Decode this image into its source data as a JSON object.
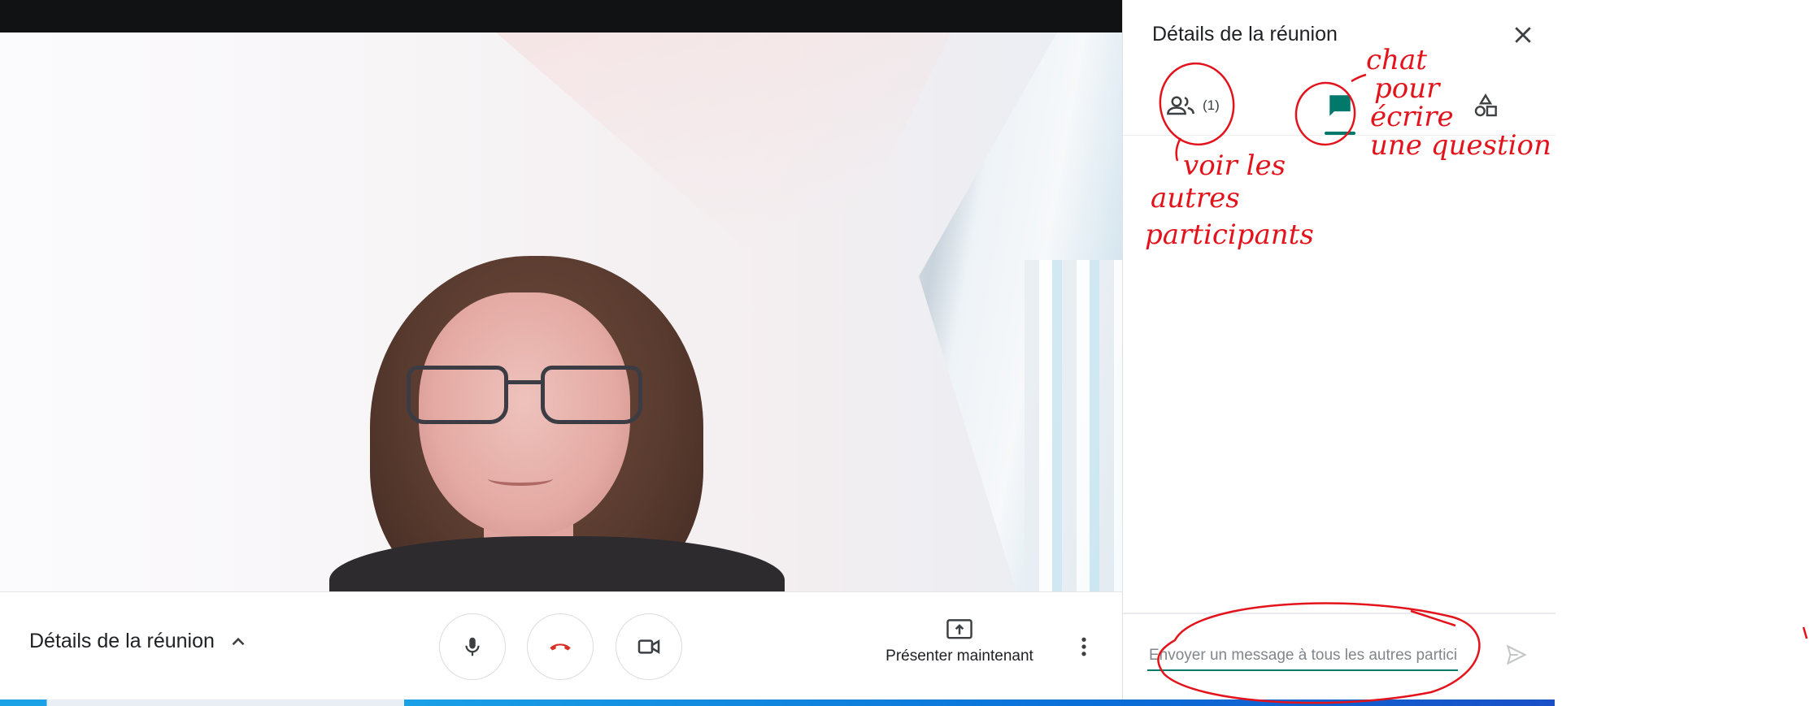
{
  "panel": {
    "title": "Détails de la réunion",
    "close_icon": "close-icon",
    "tabs": [
      {
        "name": "people",
        "icon": "people-icon",
        "count": "(1)"
      },
      {
        "name": "chat",
        "icon": "chat-icon",
        "active": true
      },
      {
        "name": "activities",
        "icon": "shapes-icon"
      }
    ],
    "message_input": {
      "placeholder": "Envoyer un message à tous les autres partici...",
      "value": ""
    },
    "send_icon": "send-icon"
  },
  "controls": {
    "meeting_details_label": "Détails de la réunion",
    "mic_icon": "mic-icon",
    "hangup_icon": "hangup-icon",
    "camera_icon": "camera-icon",
    "present_label": "Présenter maintenant",
    "present_icon": "present-screen-icon",
    "more_icon": "more-vert-icon"
  },
  "annotations": {
    "chat_note": [
      "chat",
      "pour",
      "écrire",
      "une question"
    ],
    "people_note": [
      "voir les",
      "autres",
      "participants"
    ]
  },
  "colors": {
    "accent": "#00796b",
    "hangup": "#d93025",
    "annotation_ink": "#e3131c",
    "topbar": "#111214"
  }
}
